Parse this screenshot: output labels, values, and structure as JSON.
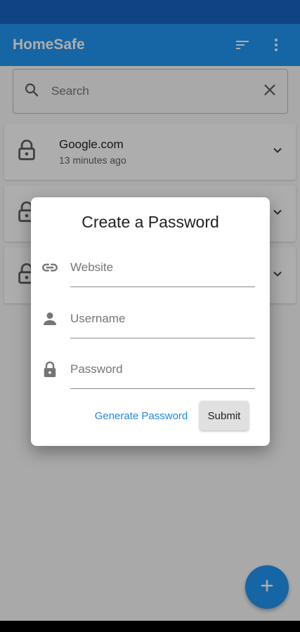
{
  "app": {
    "title": "HomeSafe"
  },
  "icons": {
    "sort": "sort-icon",
    "more": "more-vert-icon",
    "search": "search-icon",
    "clear": "close-icon",
    "lock": "lock-icon",
    "expand": "chevron-down-icon",
    "link": "link-icon",
    "person": "person-icon",
    "add": "add-icon"
  },
  "search": {
    "placeholder": "Search"
  },
  "entries": [
    {
      "site": "Google.com",
      "time": "13 minutes ago"
    },
    {
      "site": "",
      "time": ""
    },
    {
      "site": "",
      "time": ""
    }
  ],
  "dialog": {
    "title": "Create a Password",
    "website_placeholder": "Website",
    "username_placeholder": "Username",
    "password_placeholder": "Password",
    "generate_label": "Generate Password",
    "submit_label": "Submit"
  },
  "colors": {
    "primary": "#2196f3",
    "status_bar": "#1565c0",
    "accent_text": "#1e88e5"
  }
}
